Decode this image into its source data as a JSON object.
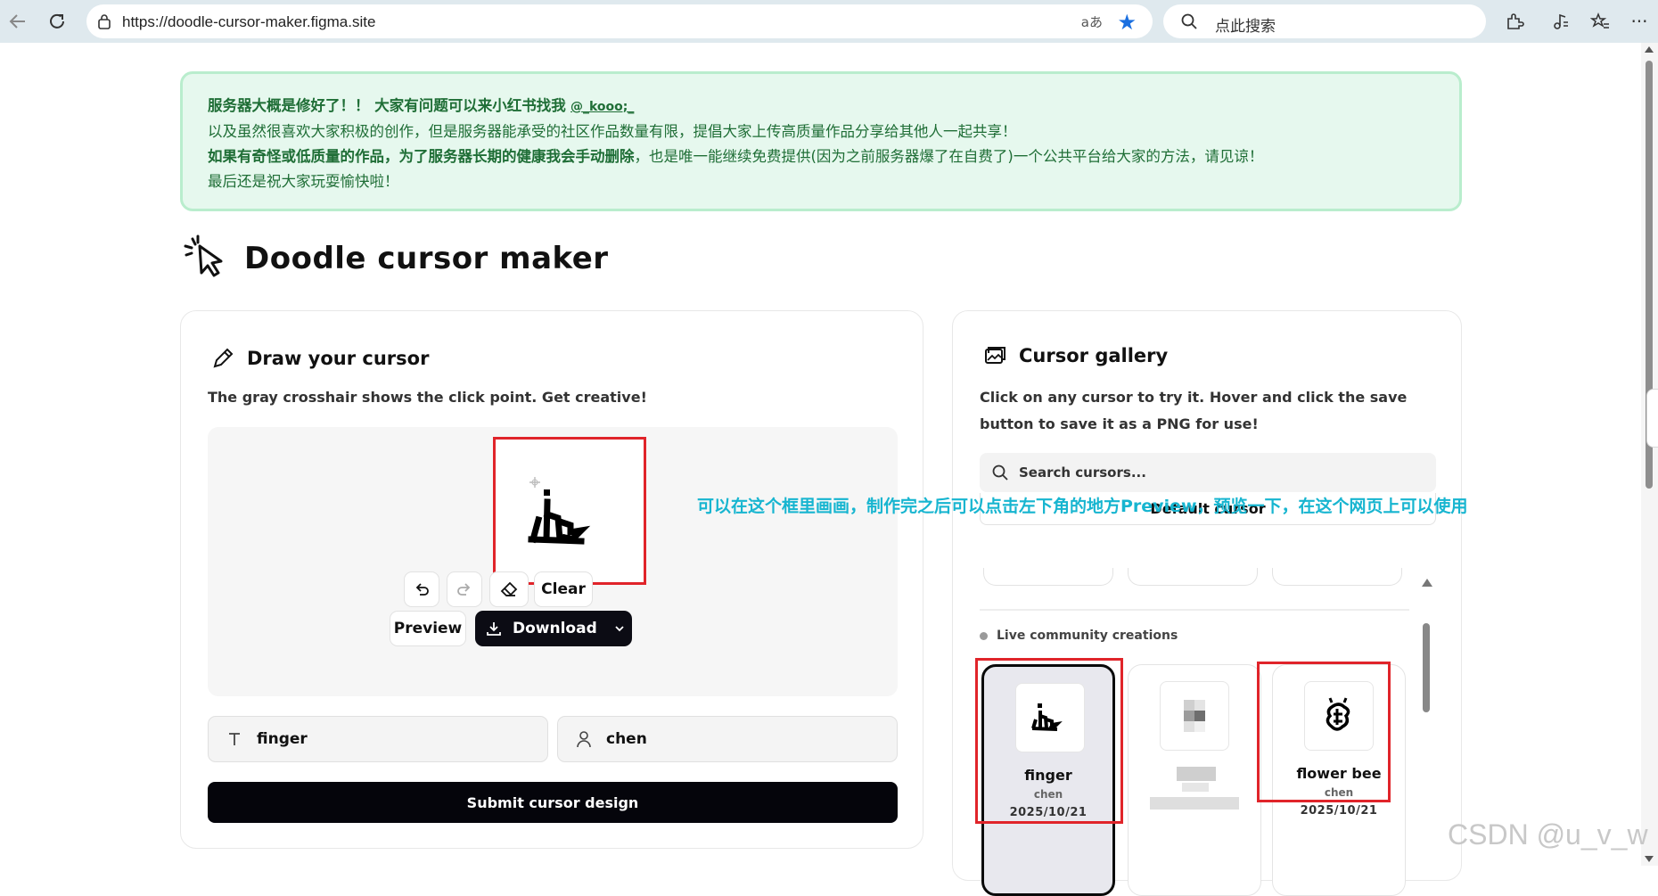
{
  "browser": {
    "url": "https://doodle-cursor-maker.figma.site",
    "read_aloud": "aあ",
    "search_placeholder": "点此搜索"
  },
  "notice": {
    "line1_bold": "服务器大概是修好了！！ 大家有问题可以来小红书找我",
    "line1_link": "@_kooo;_",
    "line2": "以及虽然很喜欢大家积极的创作，但是服务器能承受的社区作品数量有限，提倡大家上传高质量作品分享给其他人一起共享！",
    "line3_bold": "如果有奇怪或低质量的作品，为了服务器长期的健康我会手动删除",
    "line3_rest": "，也是唯一能继续免费提供(因为之前服务器爆了在自费了)一个公共平台给大家的方法，请见谅！",
    "line4": "最后还是祝大家玩耍愉快啦！"
  },
  "brand": {
    "title": "Doodle cursor maker"
  },
  "draw": {
    "title": "Draw your cursor",
    "subtitle": "The gray crosshair shows the click point. Get creative!",
    "clear_label": "Clear",
    "preview_label": "Preview",
    "download_label": "Download",
    "name_value": "finger",
    "author_value": "chen",
    "submit_label": "Submit cursor design"
  },
  "annotation": "可以在这个框里画画，制作完之后可以点击左下角的地方Preview，预览一下，在这个网页上可以使用",
  "gallery": {
    "title": "Cursor gallery",
    "subtitle": "Click on any cursor to try it. Hover and click the save button to save it as a PNG for use!",
    "search_placeholder": "Search cursors...",
    "default_label": "Default cursor",
    "live_label": "Live community creations",
    "items": [
      {
        "name": "finger",
        "author": "chen",
        "date": "2025/10/21"
      },
      {
        "name": "",
        "author": "",
        "date": ""
      },
      {
        "name": "flower bee",
        "author": "chen",
        "date": "2025/10/21"
      }
    ]
  },
  "watermark": "CSDN @u_v_w",
  "colors": {
    "notice_text": "#1f6e36",
    "notice_bg": "#e6f8ee",
    "annotation": "#17b5d0",
    "highlight": "#e0242a",
    "star": "#1a6fe0"
  }
}
